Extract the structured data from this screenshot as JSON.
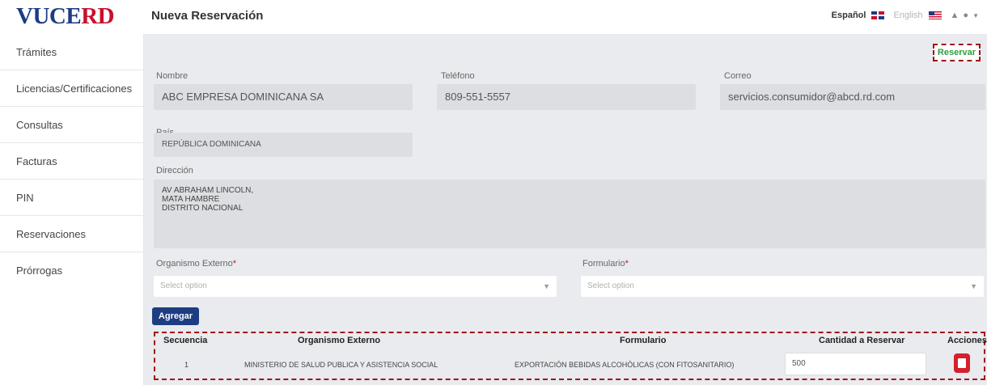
{
  "header": {
    "logo": {
      "part1": "V",
      "part2": "U",
      "part3": "CE",
      "part4": "RD"
    },
    "title": "Nueva Reservación",
    "lang_es": "Español",
    "lang_en": "English",
    "bell_icon": "bell-icon",
    "user_icon": "user-icon"
  },
  "sidebar": {
    "items": [
      {
        "label": "Trámites"
      },
      {
        "label": "Licencias/Certificaciones"
      },
      {
        "label": "Consultas"
      },
      {
        "label": "Facturas"
      },
      {
        "label": "PIN"
      },
      {
        "label": "Reservaciones"
      },
      {
        "label": "Prórrogas"
      }
    ]
  },
  "form": {
    "reservar_label": "Reservar",
    "nombre": {
      "label": "Nombre",
      "value": "ABC EMPRESA DOMINICANA SA"
    },
    "telefono": {
      "label": "Teléfono",
      "value": "809-551-5557"
    },
    "correo": {
      "label": "Correo",
      "value": "servicios.consumidor@abcd.rd.com"
    },
    "pais": {
      "label": "País",
      "value": "REPÚBLICA DOMINICANA"
    },
    "direccion": {
      "label": "Dirección",
      "line1": "AV ABRAHAM LINCOLN,",
      "line2": "MATA HAMBRE",
      "line3": "DISTRITO NACIONAL"
    },
    "organismo": {
      "label": "Organismo Externo",
      "required_mark": "*",
      "placeholder": "Select option"
    },
    "formulario": {
      "label": "Formulario",
      "required_mark": "*",
      "placeholder": "Select option"
    },
    "agregar_label": "Agregar"
  },
  "table": {
    "headers": [
      "Secuencia",
      "Organismo Externo",
      "Formulario",
      "Cantidad a Reservar",
      "Acciones"
    ],
    "rows": [
      {
        "secuencia": "1",
        "organismo": "MINISTERIO DE SALUD PUBLICA Y ASISTENCIA SOCIAL",
        "formulario": "EXPORTACIÓN BEBIDAS ALCOHÓLICAS (CON FITOSANITARIO)",
        "cantidad": "500"
      }
    ]
  },
  "colors": {
    "brand_blue": "#1d3d83",
    "brand_red": "#c8102e",
    "success_green": "#2d9e3f",
    "highlight_dashed": "#a01518",
    "delete_red": "#d61f2c"
  }
}
